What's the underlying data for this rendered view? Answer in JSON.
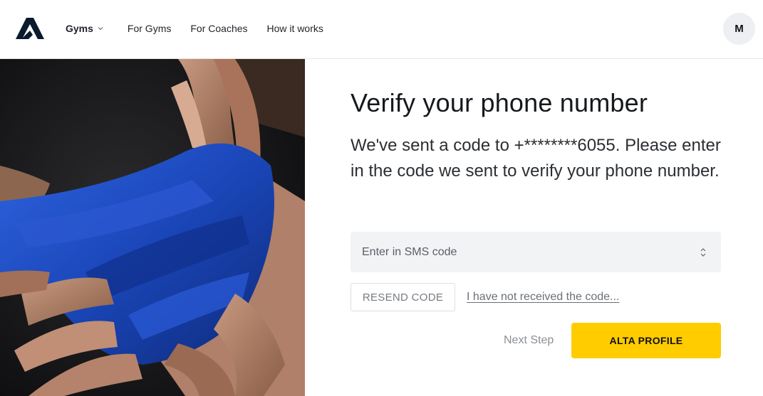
{
  "header": {
    "nav": [
      {
        "label": "Gyms",
        "has_dropdown": true
      },
      {
        "label": "For Gyms"
      },
      {
        "label": "For Coaches"
      },
      {
        "label": "How it works"
      }
    ],
    "avatar_initial": "M"
  },
  "hero_image": {
    "icon": "hand-wrap-photo"
  },
  "form": {
    "title": "Verify your phone number",
    "description": "We've sent a code to +********6055. Please enter in the code we sent to verify your phone number.",
    "sms_placeholder": "Enter in SMS code",
    "sms_value": "",
    "resend_label": "RESEND CODE",
    "no_code_link": "I have not received the code...",
    "next_step_label": "Next Step",
    "primary_button_label": "ALTA PROFILE"
  },
  "colors": {
    "accent": "#ffcc00",
    "input_bg": "#f2f3f5",
    "tape_blue": "#1a46b8"
  }
}
